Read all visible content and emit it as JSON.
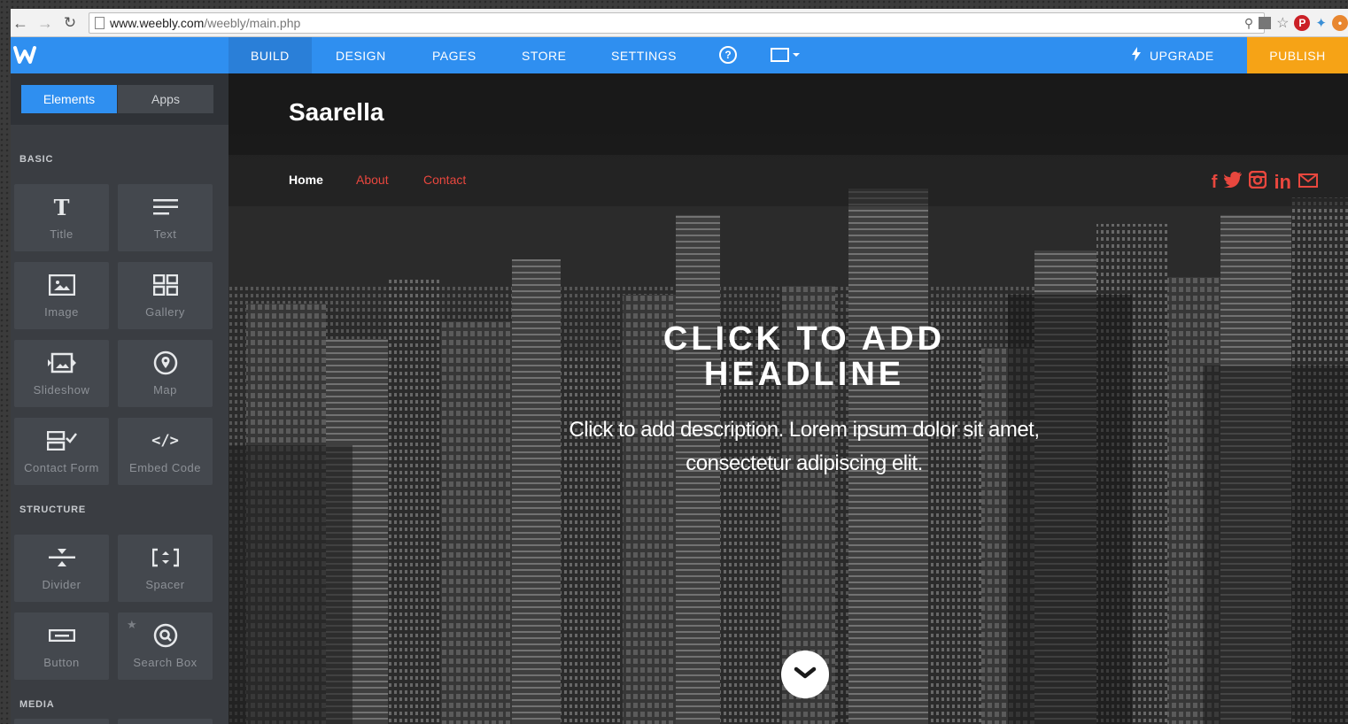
{
  "browser": {
    "url_host": "www.weebly.com",
    "url_path": "/weebly/main.php"
  },
  "topnav": {
    "logo": "W",
    "items": [
      "BUILD",
      "DESIGN",
      "PAGES",
      "STORE",
      "SETTINGS"
    ],
    "help": "?",
    "upgrade": "UPGRADE",
    "publish": "PUBLISH"
  },
  "sidebar": {
    "tabs": [
      "Elements",
      "Apps"
    ],
    "sections": {
      "basic": "BASIC",
      "structure": "STRUCTURE",
      "media": "MEDIA"
    },
    "basic_tiles": [
      "Title",
      "Text",
      "Image",
      "Gallery",
      "Slideshow",
      "Map",
      "Contact Form",
      "Embed Code"
    ],
    "structure_tiles": [
      "Divider",
      "Spacer",
      "Button",
      "Search Box"
    ]
  },
  "site": {
    "title": "Saarella",
    "nav": [
      "Home",
      "About",
      "Contact"
    ],
    "headline_line1": "CLICK TO ADD",
    "headline_line2": "HEADLINE",
    "desc_line1": "Click to add description. Lorem ipsum dolor sit amet,",
    "desc_line2": "consectetur adipiscing elit."
  },
  "colors": {
    "brand_blue": "#2f8ff0",
    "publish_orange": "#f6a316",
    "nav_link_red": "#e8473e"
  }
}
